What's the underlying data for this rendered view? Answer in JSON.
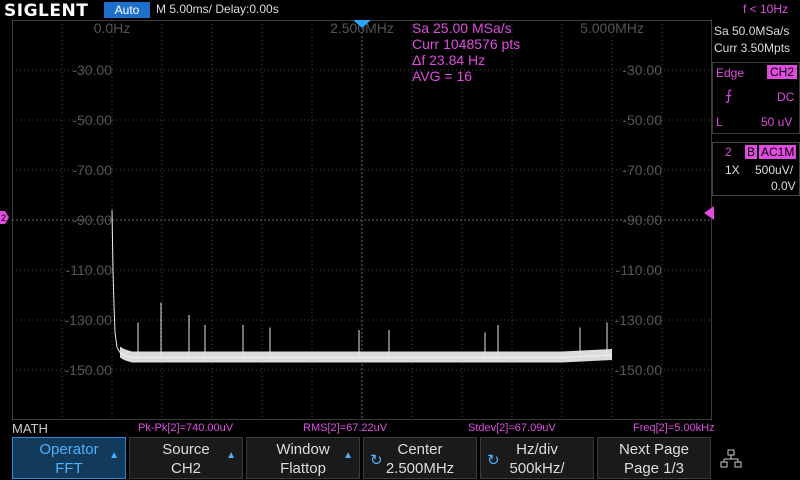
{
  "header": {
    "brand": "SIGLENT",
    "mode": "Auto",
    "timebase": "M 5.00ms/ Delay:0.00s",
    "trigger_freq": "f < 10Hz"
  },
  "overlay": {
    "sa": "Sa 25.00 MSa/s",
    "curr": "Curr 1048576 pts",
    "df": "Δf 23.84 Hz",
    "avg": "AVG = 16"
  },
  "chart_data": {
    "type": "line",
    "title": "",
    "xlabel": "",
    "ylabel": "",
    "x_ticks": [
      "0.0Hz",
      "2.500MHz",
      "5.000MHz"
    ],
    "y_ticks": [
      "-30.00",
      "-50.00",
      "-70.00",
      "-90.00",
      "-110.00",
      "-130.00",
      "-150.00"
    ],
    "xlim_mhz": [
      0,
      5.0
    ],
    "ylim_db": [
      -10,
      -170
    ],
    "series": [
      {
        "x": [
          0.0,
          0.01,
          0.02,
          0.03,
          0.05,
          0.08,
          0.12,
          0.2,
          0.5,
          1.0,
          1.5,
          2.0,
          2.5,
          3.0,
          3.5,
          4.0,
          4.5,
          5.0
        ],
        "y": [
          -86,
          -110,
          -124,
          -135,
          -141,
          -143,
          -144,
          -145,
          -145,
          -145,
          -145,
          -145,
          -145,
          -145,
          -145,
          -145,
          -145,
          -144
        ]
      }
    ],
    "spurs": [
      {
        "x": 0.26,
        "y": -131
      },
      {
        "x": 0.49,
        "y": -123
      },
      {
        "x": 0.77,
        "y": -128
      },
      {
        "x": 0.93,
        "y": -132
      },
      {
        "x": 1.31,
        "y": -132
      },
      {
        "x": 1.58,
        "y": -133
      },
      {
        "x": 2.47,
        "y": -134
      },
      {
        "x": 2.77,
        "y": -134
      },
      {
        "x": 3.73,
        "y": -135
      },
      {
        "x": 3.86,
        "y": -132
      },
      {
        "x": 4.68,
        "y": -133
      },
      {
        "x": 4.95,
        "y": -131
      }
    ],
    "grid": true
  },
  "right_panel": {
    "sa": "Sa 50.0MSa/s",
    "curr": "Curr 3.50Mpts",
    "trig_type": "Edge",
    "trig_source": "CH2",
    "trig_coupling": "DC",
    "trig_level_label": "L",
    "trig_level": "50 uV",
    "ch_num": "2",
    "ch_bw": "B",
    "ch_coupling": "AC1M",
    "probe": "1X",
    "vdiv": "500uV/",
    "offset": "0.0V"
  },
  "math": {
    "title": "MATH",
    "pkpk": "Pk-Pk[2]=740.00uV",
    "rms": "RMS[2]=67.22uV",
    "stdev": "Stdev[2]=67.09uV",
    "freq": "Freq[2]=5.00kHz"
  },
  "softkeys": [
    {
      "l1": "Operator",
      "l2": "FFT"
    },
    {
      "l1": "Source",
      "l2": "CH2"
    },
    {
      "l1": "Window",
      "l2": "Flattop"
    },
    {
      "l1": "Center",
      "l2": "2.500MHz"
    },
    {
      "l1": "Hz/div",
      "l2": "500kHz/"
    },
    {
      "l1": "Next Page",
      "l2": "Page 1/3"
    }
  ],
  "colors": {
    "accent": "#1e6fc9",
    "math": "#e04ce0",
    "trace": "#e8e8e8"
  }
}
